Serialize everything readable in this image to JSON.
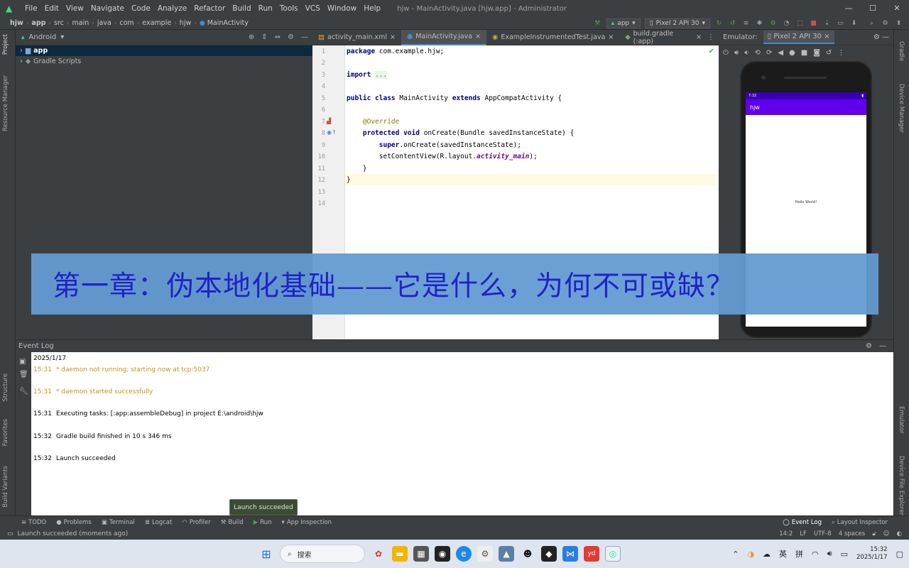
{
  "window": {
    "menu": [
      "File",
      "Edit",
      "View",
      "Navigate",
      "Code",
      "Analyze",
      "Refactor",
      "Build",
      "Run",
      "Tools",
      "VCS",
      "Window",
      "Help"
    ],
    "title": "hjw - MainActivity.java [hjw.app] - Administrator",
    "controls": [
      "—",
      "☐",
      "✕"
    ]
  },
  "breadcrumb": [
    "hjw",
    "app",
    "src",
    "main",
    "java",
    "com",
    "example",
    "hjw",
    "MainActivity"
  ],
  "toolbar": {
    "run_config": "app",
    "device": "Pixel 2 API 30"
  },
  "project_panel": {
    "view": "Android",
    "items": [
      {
        "label": "app"
      },
      {
        "label": "Gradle Scripts"
      }
    ]
  },
  "editor": {
    "tabs": [
      "activity_main.xml",
      "MainActivity.java",
      "ExampleInstrumentedTest.java",
      "build.gradle (:app)"
    ],
    "active_tab": 1,
    "line_numbers": [
      "1",
      "2",
      "3",
      "4",
      "5",
      "6",
      "7",
      "8",
      "9",
      "10",
      "11",
      "12",
      "13",
      "14"
    ]
  },
  "emulator": {
    "label": "Emulator:",
    "tab": "Pixel 2 API 30",
    "status_time": "7:32",
    "app_title": "hjw",
    "hello_text": "Hello World!"
  },
  "event_log": {
    "title": "Event Log",
    "date": "2025/1/17",
    "entries": [
      {
        "time": "15:31",
        "text": "* daemon not running; starting now at tcp:5037",
        "level": "warn"
      },
      {
        "time": "15:31",
        "text": "* daemon started successfully",
        "level": "warn"
      },
      {
        "time": "15:31",
        "text": "Executing tasks: [:app:assembleDebug] in project E:\\android\\hjw",
        "level": "info"
      },
      {
        "time": "15:32",
        "text": "Gradle build finished in 10 s 346 ms",
        "level": "info"
      },
      {
        "time": "15:32",
        "text": "Launch succeeded",
        "level": "info"
      }
    ]
  },
  "left_stripe": [
    "Project",
    "Resource Manager",
    "Structure",
    "Favorites",
    "Build Variants"
  ],
  "right_stripe": [
    "Gradle",
    "Device Manager",
    "Emulator",
    "Device File Explorer"
  ],
  "bottom_tabs": [
    "TODO",
    "Problems",
    "Terminal",
    "Logcat",
    "Profiler",
    "Build",
    "Run",
    "App Inspection"
  ],
  "bottom_right_tabs": [
    "Event Log",
    "Layout Inspector"
  ],
  "tooltip": "Launch succeeded",
  "status": {
    "message": "Launch succeeded (moments ago)",
    "position": "14:2",
    "line_sep": "LF",
    "encoding": "UTF-8",
    "indent": "4 spaces"
  },
  "taskbar": {
    "search_placeholder": "搜索",
    "ime_lang": "英",
    "ime_mode": "拼",
    "time": "15:32",
    "date": "2025/1/17"
  },
  "banner": "第一章：伪本地化基础——它是什么，为何不可或缺？"
}
